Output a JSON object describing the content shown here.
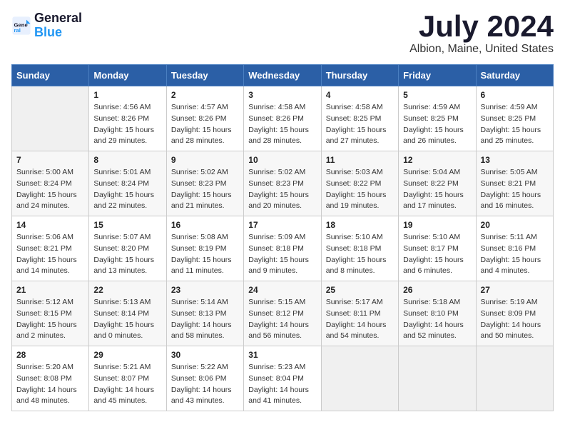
{
  "header": {
    "logo_line1": "General",
    "logo_line2": "Blue",
    "month": "July 2024",
    "location": "Albion, Maine, United States"
  },
  "weekdays": [
    "Sunday",
    "Monday",
    "Tuesday",
    "Wednesday",
    "Thursday",
    "Friday",
    "Saturday"
  ],
  "weeks": [
    [
      {
        "day": "",
        "info": ""
      },
      {
        "day": "1",
        "info": "Sunrise: 4:56 AM\nSunset: 8:26 PM\nDaylight: 15 hours\nand 29 minutes."
      },
      {
        "day": "2",
        "info": "Sunrise: 4:57 AM\nSunset: 8:26 PM\nDaylight: 15 hours\nand 28 minutes."
      },
      {
        "day": "3",
        "info": "Sunrise: 4:58 AM\nSunset: 8:26 PM\nDaylight: 15 hours\nand 28 minutes."
      },
      {
        "day": "4",
        "info": "Sunrise: 4:58 AM\nSunset: 8:25 PM\nDaylight: 15 hours\nand 27 minutes."
      },
      {
        "day": "5",
        "info": "Sunrise: 4:59 AM\nSunset: 8:25 PM\nDaylight: 15 hours\nand 26 minutes."
      },
      {
        "day": "6",
        "info": "Sunrise: 4:59 AM\nSunset: 8:25 PM\nDaylight: 15 hours\nand 25 minutes."
      }
    ],
    [
      {
        "day": "7",
        "info": "Sunrise: 5:00 AM\nSunset: 8:24 PM\nDaylight: 15 hours\nand 24 minutes."
      },
      {
        "day": "8",
        "info": "Sunrise: 5:01 AM\nSunset: 8:24 PM\nDaylight: 15 hours\nand 22 minutes."
      },
      {
        "day": "9",
        "info": "Sunrise: 5:02 AM\nSunset: 8:23 PM\nDaylight: 15 hours\nand 21 minutes."
      },
      {
        "day": "10",
        "info": "Sunrise: 5:02 AM\nSunset: 8:23 PM\nDaylight: 15 hours\nand 20 minutes."
      },
      {
        "day": "11",
        "info": "Sunrise: 5:03 AM\nSunset: 8:22 PM\nDaylight: 15 hours\nand 19 minutes."
      },
      {
        "day": "12",
        "info": "Sunrise: 5:04 AM\nSunset: 8:22 PM\nDaylight: 15 hours\nand 17 minutes."
      },
      {
        "day": "13",
        "info": "Sunrise: 5:05 AM\nSunset: 8:21 PM\nDaylight: 15 hours\nand 16 minutes."
      }
    ],
    [
      {
        "day": "14",
        "info": "Sunrise: 5:06 AM\nSunset: 8:21 PM\nDaylight: 15 hours\nand 14 minutes."
      },
      {
        "day": "15",
        "info": "Sunrise: 5:07 AM\nSunset: 8:20 PM\nDaylight: 15 hours\nand 13 minutes."
      },
      {
        "day": "16",
        "info": "Sunrise: 5:08 AM\nSunset: 8:19 PM\nDaylight: 15 hours\nand 11 minutes."
      },
      {
        "day": "17",
        "info": "Sunrise: 5:09 AM\nSunset: 8:18 PM\nDaylight: 15 hours\nand 9 minutes."
      },
      {
        "day": "18",
        "info": "Sunrise: 5:10 AM\nSunset: 8:18 PM\nDaylight: 15 hours\nand 8 minutes."
      },
      {
        "day": "19",
        "info": "Sunrise: 5:10 AM\nSunset: 8:17 PM\nDaylight: 15 hours\nand 6 minutes."
      },
      {
        "day": "20",
        "info": "Sunrise: 5:11 AM\nSunset: 8:16 PM\nDaylight: 15 hours\nand 4 minutes."
      }
    ],
    [
      {
        "day": "21",
        "info": "Sunrise: 5:12 AM\nSunset: 8:15 PM\nDaylight: 15 hours\nand 2 minutes."
      },
      {
        "day": "22",
        "info": "Sunrise: 5:13 AM\nSunset: 8:14 PM\nDaylight: 15 hours\nand 0 minutes."
      },
      {
        "day": "23",
        "info": "Sunrise: 5:14 AM\nSunset: 8:13 PM\nDaylight: 14 hours\nand 58 minutes."
      },
      {
        "day": "24",
        "info": "Sunrise: 5:15 AM\nSunset: 8:12 PM\nDaylight: 14 hours\nand 56 minutes."
      },
      {
        "day": "25",
        "info": "Sunrise: 5:17 AM\nSunset: 8:11 PM\nDaylight: 14 hours\nand 54 minutes."
      },
      {
        "day": "26",
        "info": "Sunrise: 5:18 AM\nSunset: 8:10 PM\nDaylight: 14 hours\nand 52 minutes."
      },
      {
        "day": "27",
        "info": "Sunrise: 5:19 AM\nSunset: 8:09 PM\nDaylight: 14 hours\nand 50 minutes."
      }
    ],
    [
      {
        "day": "28",
        "info": "Sunrise: 5:20 AM\nSunset: 8:08 PM\nDaylight: 14 hours\nand 48 minutes."
      },
      {
        "day": "29",
        "info": "Sunrise: 5:21 AM\nSunset: 8:07 PM\nDaylight: 14 hours\nand 45 minutes."
      },
      {
        "day": "30",
        "info": "Sunrise: 5:22 AM\nSunset: 8:06 PM\nDaylight: 14 hours\nand 43 minutes."
      },
      {
        "day": "31",
        "info": "Sunrise: 5:23 AM\nSunset: 8:04 PM\nDaylight: 14 hours\nand 41 minutes."
      },
      {
        "day": "",
        "info": ""
      },
      {
        "day": "",
        "info": ""
      },
      {
        "day": "",
        "info": ""
      }
    ]
  ]
}
